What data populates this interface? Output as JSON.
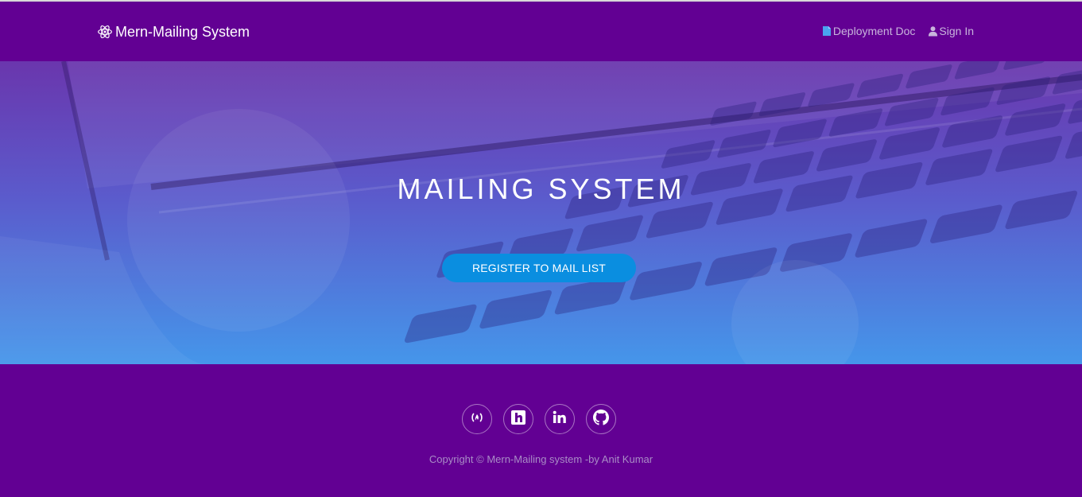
{
  "navbar": {
    "brand": {
      "icon": "react-atom-icon",
      "label": "Mern-Mailing System"
    },
    "links": [
      {
        "icon": "document-icon",
        "label": "Deployment Doc"
      },
      {
        "icon": "user-icon",
        "label": "Sign In"
      }
    ]
  },
  "hero": {
    "title": "MAILING SYSTEM",
    "button_label": "REGISTER TO MAIL LIST"
  },
  "footer": {
    "socials": [
      {
        "icon": "freecodecamp-icon"
      },
      {
        "icon": "hashnode-icon"
      },
      {
        "icon": "linkedin-icon"
      },
      {
        "icon": "github-icon"
      }
    ],
    "copyright": "Copyright © Mern-Mailing system -by Anit Kumar"
  },
  "colors": {
    "nav_bg": "#620093",
    "footer_bg": "#620093",
    "button_bg": "#0a8ee0",
    "hero_gradient_top": "#6a36ad",
    "hero_gradient_bottom": "#4596ea"
  }
}
